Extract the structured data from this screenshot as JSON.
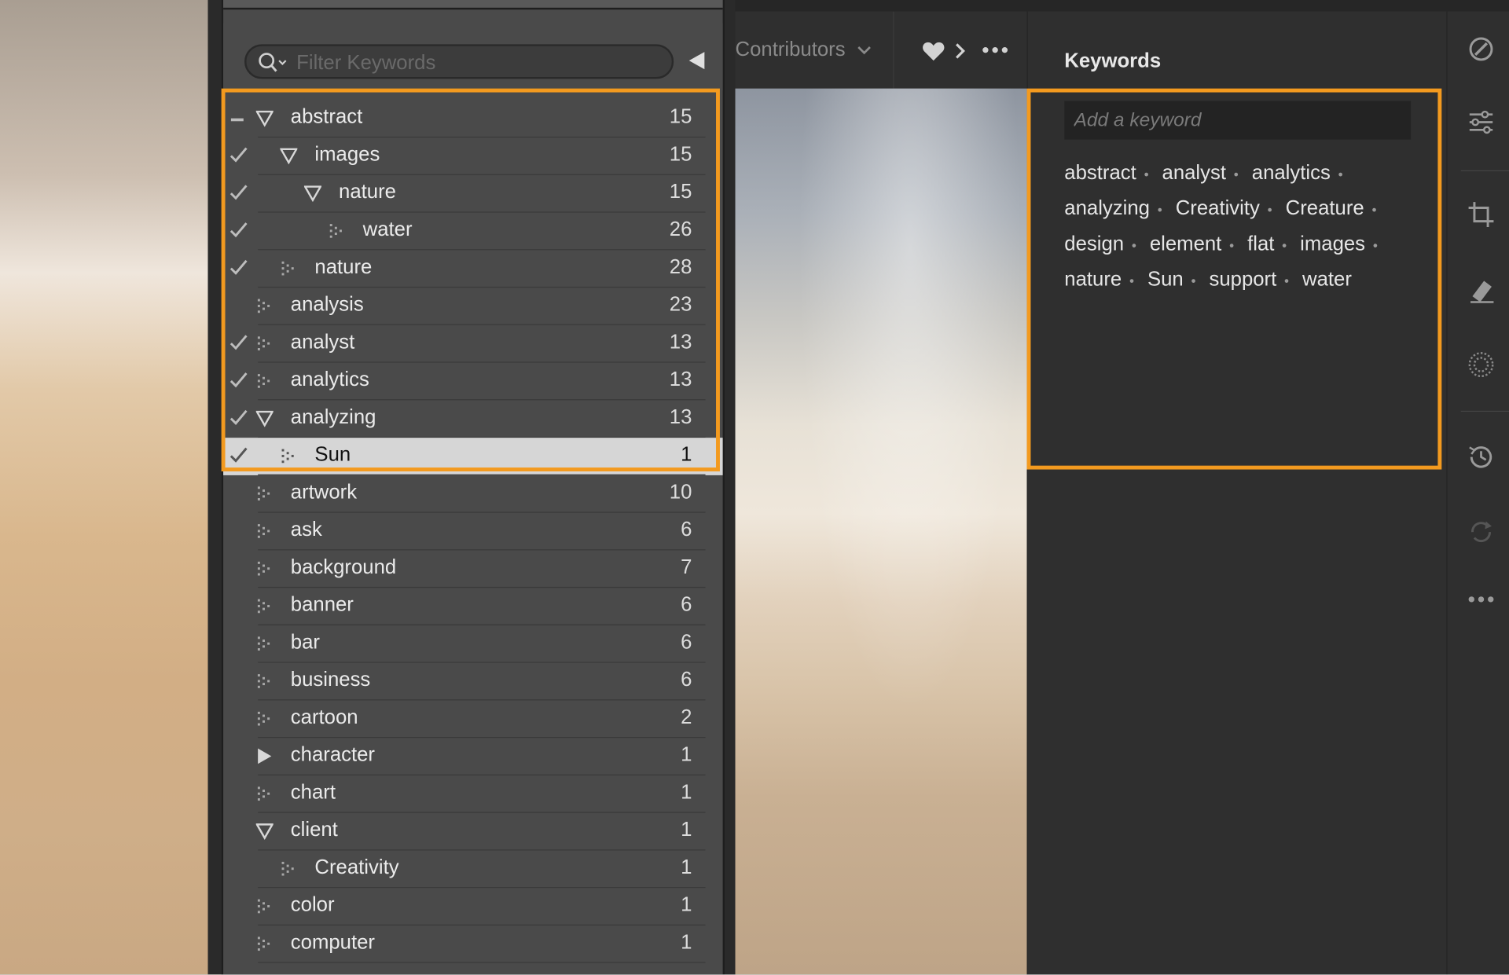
{
  "filter": {
    "placeholder": "Filter Keywords"
  },
  "keyword_list": [
    {
      "label": "abstract",
      "count": "15",
      "indent": 0,
      "expander": "open",
      "mark": "dash",
      "selected": false
    },
    {
      "label": "images",
      "count": "15",
      "indent": 1,
      "expander": "open",
      "mark": "check",
      "selected": false
    },
    {
      "label": "nature",
      "count": "15",
      "indent": 2,
      "expander": "open",
      "mark": "check",
      "selected": false
    },
    {
      "label": "water",
      "count": "26",
      "indent": 3,
      "expander": "leaf",
      "mark": "check",
      "selected": false
    },
    {
      "label": "nature",
      "count": "28",
      "indent": 1,
      "expander": "leaf",
      "mark": "check",
      "selected": false
    },
    {
      "label": "analysis",
      "count": "23",
      "indent": 0,
      "expander": "leaf",
      "mark": "none",
      "selected": false
    },
    {
      "label": "analyst",
      "count": "13",
      "indent": 0,
      "expander": "leaf",
      "mark": "check",
      "selected": false
    },
    {
      "label": "analytics",
      "count": "13",
      "indent": 0,
      "expander": "leaf",
      "mark": "check",
      "selected": false
    },
    {
      "label": "analyzing",
      "count": "13",
      "indent": 0,
      "expander": "open",
      "mark": "check",
      "selected": false
    },
    {
      "label": "Sun",
      "count": "1",
      "indent": 1,
      "expander": "leaf",
      "mark": "check",
      "selected": true
    },
    {
      "label": "artwork",
      "count": "10",
      "indent": 0,
      "expander": "leaf",
      "mark": "none",
      "selected": false
    },
    {
      "label": "ask",
      "count": "6",
      "indent": 0,
      "expander": "leaf",
      "mark": "none",
      "selected": false
    },
    {
      "label": "background",
      "count": "7",
      "indent": 0,
      "expander": "leaf",
      "mark": "none",
      "selected": false
    },
    {
      "label": "banner",
      "count": "6",
      "indent": 0,
      "expander": "leaf",
      "mark": "none",
      "selected": false
    },
    {
      "label": "bar",
      "count": "6",
      "indent": 0,
      "expander": "leaf",
      "mark": "none",
      "selected": false
    },
    {
      "label": "business",
      "count": "6",
      "indent": 0,
      "expander": "leaf",
      "mark": "none",
      "selected": false
    },
    {
      "label": "cartoon",
      "count": "2",
      "indent": 0,
      "expander": "leaf",
      "mark": "none",
      "selected": false
    },
    {
      "label": "character",
      "count": "1",
      "indent": 0,
      "expander": "closed",
      "mark": "none",
      "selected": false
    },
    {
      "label": "chart",
      "count": "1",
      "indent": 0,
      "expander": "leaf",
      "mark": "none",
      "selected": false
    },
    {
      "label": "client",
      "count": "1",
      "indent": 0,
      "expander": "open",
      "mark": "none",
      "selected": false
    },
    {
      "label": "Creativity",
      "count": "1",
      "indent": 1,
      "expander": "leaf",
      "mark": "none",
      "selected": false
    },
    {
      "label": "color",
      "count": "1",
      "indent": 0,
      "expander": "leaf",
      "mark": "none",
      "selected": false
    },
    {
      "label": "computer",
      "count": "1",
      "indent": 0,
      "expander": "leaf",
      "mark": "none",
      "selected": false
    }
  ],
  "toolbar": {
    "contributors_label": "Contributors"
  },
  "keywords_panel": {
    "title": "Keywords",
    "add_placeholder": "Add a keyword",
    "tags": [
      "abstract",
      "analyst",
      "analytics",
      "analyzing",
      "Creativity",
      "Creature",
      "design",
      "element",
      "flat",
      "images",
      "nature",
      "Sun",
      "support",
      "water"
    ]
  },
  "colors": {
    "highlight": "#f39a1f",
    "panel": "#4a4a4a",
    "dark_panel": "#2f2f2f",
    "selected_row": "#d6d6d6"
  },
  "icons": [
    "search-icon",
    "collapse-panel-icon",
    "chevron-down-icon",
    "heart-icon",
    "chevron-right-icon",
    "more-icon",
    "edit-icon",
    "sliders-icon",
    "crop-icon",
    "healing-icon",
    "masking-icon",
    "history-icon",
    "sync-icon",
    "more-vertical-icon"
  ]
}
